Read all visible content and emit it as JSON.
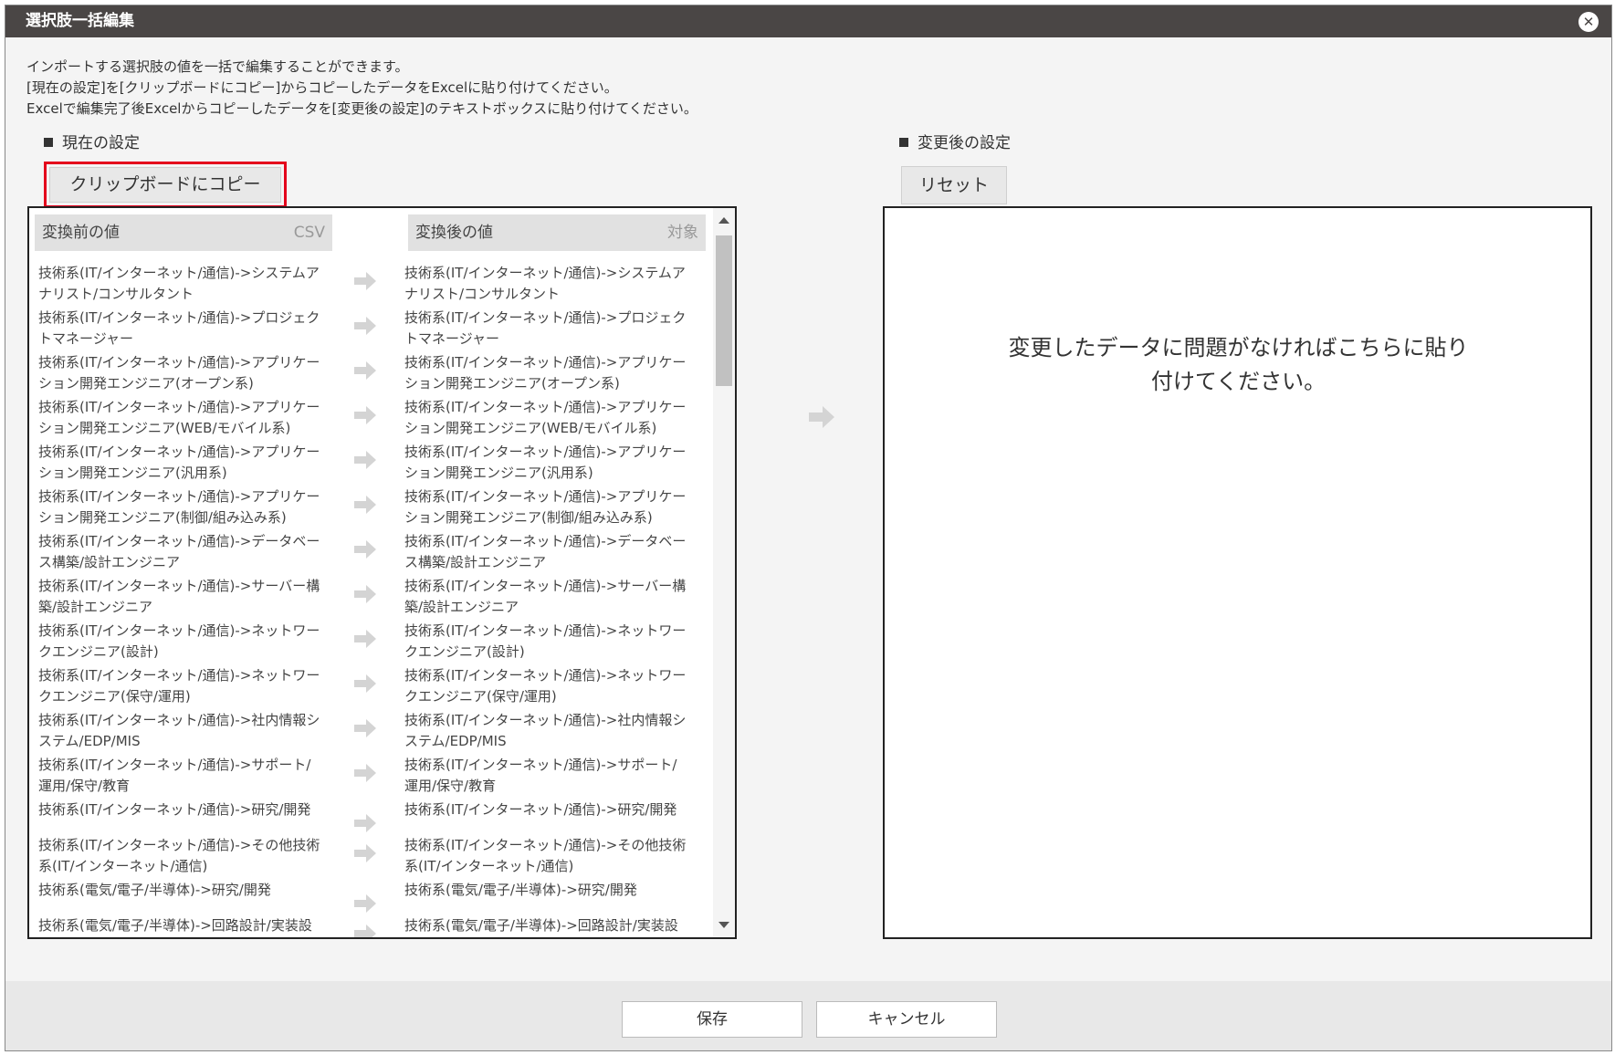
{
  "dialog": {
    "title": "選択肢一括編集",
    "close_glyph": "✕"
  },
  "description": [
    "インポートする選択肢の値を一括で編集することができます。",
    "[現在の設定]を[クリップボードにコピー]からコピーしたデータをExcelに貼り付けてください。",
    "Excelで編集完了後Excelからコピーしたデータを[変更後の設定]のテキストボックスに貼り付けてください。"
  ],
  "current": {
    "label": "現在の設定",
    "copy_button": "クリップボードにコピー",
    "header_before": "変換前の値",
    "header_before_tag": "CSV",
    "header_after": "変換後の値",
    "header_after_tag": "対象",
    "rows": [
      [
        "技術系(IT/インターネット/通信)->システムア",
        "ナリスト/コンサルタント",
        "技術系(IT/インターネット/通信)->システムア",
        "ナリスト/コンサルタント"
      ],
      [
        "技術系(IT/インターネット/通信)->プロジェク",
        "トマネージャー",
        "技術系(IT/インターネット/通信)->プロジェク",
        "トマネージャー"
      ],
      [
        "技術系(IT/インターネット/通信)->アプリケー",
        "ション開発エンジニア(オープン系)",
        "技術系(IT/インターネット/通信)->アプリケー",
        "ション開発エンジニア(オープン系)"
      ],
      [
        "技術系(IT/インターネット/通信)->アプリケー",
        "ション開発エンジニア(WEB/モバイル系)",
        "技術系(IT/インターネット/通信)->アプリケー",
        "ション開発エンジニア(WEB/モバイル系)"
      ],
      [
        "技術系(IT/インターネット/通信)->アプリケー",
        "ション開発エンジニア(汎用系)",
        "技術系(IT/インターネット/通信)->アプリケー",
        "ション開発エンジニア(汎用系)"
      ],
      [
        "技術系(IT/インターネット/通信)->アプリケー",
        "ション開発エンジニア(制御/組み込み系)",
        "技術系(IT/インターネット/通信)->アプリケー",
        "ション開発エンジニア(制御/組み込み系)"
      ],
      [
        "技術系(IT/インターネット/通信)->データベー",
        "ス構築/設計エンジニア",
        "技術系(IT/インターネット/通信)->データベー",
        "ス構築/設計エンジニア"
      ],
      [
        "技術系(IT/インターネット/通信)->サーバー構",
        "築/設計エンジニア",
        "技術系(IT/インターネット/通信)->サーバー構",
        "築/設計エンジニア"
      ],
      [
        "技術系(IT/インターネット/通信)->ネットワー",
        "クエンジニア(設計)",
        "技術系(IT/インターネット/通信)->ネットワー",
        "クエンジニア(設計)"
      ],
      [
        "技術系(IT/インターネット/通信)->ネットワー",
        "クエンジニア(保守/運用)",
        "技術系(IT/インターネット/通信)->ネットワー",
        "クエンジニア(保守/運用)"
      ],
      [
        "技術系(IT/インターネット/通信)->社内情報シ",
        "ステム/EDP/MIS",
        "技術系(IT/インターネット/通信)->社内情報シ",
        "ステム/EDP/MIS"
      ],
      [
        "技術系(IT/インターネット/通信)->サポート/",
        "運用/保守/教育",
        "技術系(IT/インターネット/通信)->サポート/",
        "運用/保守/教育"
      ],
      [
        "技術系(IT/インターネット/通信)->研究/開発",
        "",
        "技術系(IT/インターネット/通信)->研究/開発",
        ""
      ],
      [
        "技術系(IT/インターネット/通信)->その他技術",
        "系(IT/インターネット/通信)",
        "技術系(IT/インターネット/通信)->その他技術",
        "系(IT/インターネット/通信)"
      ],
      [
        "技術系(電気/電子/半導体)->研究/開発",
        "",
        "技術系(電気/電子/半導体)->研究/開発",
        ""
      ],
      [
        "技術系(電気/電子/半導体)->回路設計/実装設",
        "",
        "技術系(電気/電子/半導体)->回路設計/実装設",
        ""
      ]
    ]
  },
  "changed": {
    "label": "変更後の設定",
    "reset_button": "リセット",
    "placeholder_line1": "変更したデータに問題がなければこちらに貼り",
    "placeholder_line2": "付けてください。"
  },
  "footer": {
    "save_button": "保存",
    "cancel_button": "キャンセル"
  }
}
